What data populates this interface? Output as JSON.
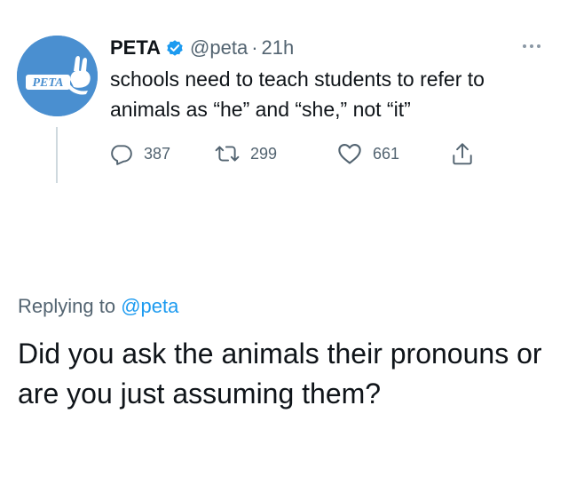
{
  "tweet": {
    "author": {
      "name": "PETA",
      "handle": "@peta",
      "avatar_text": "PETA",
      "verified": true
    },
    "separator": "·",
    "time": "21h",
    "text": "schools need to teach students to refer to animals as “he” and “she,” not “it”",
    "actions": {
      "reply_count": "387",
      "retweet_count": "299",
      "like_count": "661"
    }
  },
  "reply": {
    "context_prefix": "Replying to",
    "context_mention": "@peta",
    "text": "Did you ask the animals their pronouns or are you just assuming them?"
  },
  "colors": {
    "avatar_bg": "#4a8fd0",
    "verified_blue": "#1d9bf0",
    "secondary_text": "#536471",
    "thread_line": "#cfd9de"
  },
  "icons": [
    "peta-logo",
    "verified-badge-icon",
    "more-options-icon",
    "reply-icon",
    "retweet-icon",
    "like-icon",
    "share-icon"
  ]
}
